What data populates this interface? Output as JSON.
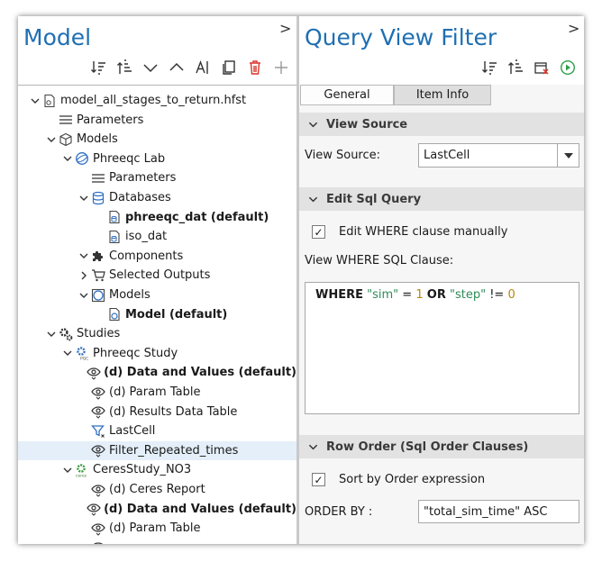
{
  "model_panel": {
    "title": "Model",
    "collapse": ">",
    "toolbar_icons": [
      "sort-descending-icon",
      "sort-ascending-icon",
      "collapse-down-icon",
      "expand-up-icon",
      "rename-ai-icon",
      "copy-icon",
      "delete-icon",
      "add-icon"
    ],
    "tree": [
      {
        "label": "model_all_stages_to_return.hfst",
        "indent": 0,
        "arrow": "down",
        "icon": "file-icon",
        "bold": false
      },
      {
        "label": "Parameters",
        "indent": 1,
        "arrow": "none",
        "icon": "list-icon",
        "bold": false
      },
      {
        "label": "Models",
        "indent": 1,
        "arrow": "down",
        "icon": "cube-icon",
        "bold": false
      },
      {
        "label": "Phreeqc Lab",
        "indent": 2,
        "arrow": "down",
        "icon": "globe-icon",
        "bold": false
      },
      {
        "label": "Parameters",
        "indent": 3,
        "arrow": "none",
        "icon": "list-icon",
        "bold": false
      },
      {
        "label": "Databases",
        "indent": 3,
        "arrow": "down",
        "icon": "database-icon",
        "bold": false
      },
      {
        "label": "phreeqc_dat (default)",
        "indent": 4,
        "arrow": "none",
        "icon": "db-file-icon",
        "bold": true
      },
      {
        "label": "iso_dat",
        "indent": 4,
        "arrow": "none",
        "icon": "db-file-icon",
        "bold": false
      },
      {
        "label": "Components",
        "indent": 3,
        "arrow": "down",
        "icon": "puzzle-icon",
        "bold": false
      },
      {
        "label": "Selected Outputs",
        "indent": 3,
        "arrow": "right",
        "icon": "cart-icon",
        "bold": false
      },
      {
        "label": "Models",
        "indent": 3,
        "arrow": "down",
        "icon": "model-circle-icon",
        "bold": false
      },
      {
        "label": "Model (default)",
        "indent": 4,
        "arrow": "none",
        "icon": "model-file-icon",
        "bold": true
      },
      {
        "label": "Studies",
        "indent": 1,
        "arrow": "down",
        "icon": "gears-icon",
        "bold": false
      },
      {
        "label": "Phreeqc Study",
        "indent": 2,
        "arrow": "down",
        "icon": "pqc-gear-icon",
        "bold": false
      },
      {
        "label": "(d) Data and Values (default)",
        "indent": 3,
        "arrow": "none",
        "icon": "eye-icon",
        "bold": true
      },
      {
        "label": "(d) Param Table",
        "indent": 3,
        "arrow": "none",
        "icon": "eye-icon",
        "bold": false
      },
      {
        "label": "(d) Results Data Table",
        "indent": 3,
        "arrow": "none",
        "icon": "eye-icon",
        "bold": false
      },
      {
        "label": "LastCell",
        "indent": 3,
        "arrow": "none",
        "icon": "filter-icon",
        "bold": false
      },
      {
        "label": "Filter_Repeated_times",
        "indent": 3,
        "arrow": "none",
        "icon": "eye-icon",
        "bold": false,
        "selected": true
      },
      {
        "label": "CeresStudy_NO3",
        "indent": 2,
        "arrow": "down",
        "icon": "ceres-gear-icon",
        "bold": false
      },
      {
        "label": "(d) Ceres Report",
        "indent": 3,
        "arrow": "none",
        "icon": "eye-icon",
        "bold": false
      },
      {
        "label": "(d) Data and Values (default)",
        "indent": 3,
        "arrow": "none",
        "icon": "eye-icon",
        "bold": true
      },
      {
        "label": "(d) Param Table",
        "indent": 3,
        "arrow": "none",
        "icon": "eye-icon",
        "bold": false
      },
      {
        "label": "",
        "indent": 3,
        "arrow": "none",
        "icon": "eye-icon",
        "bold": false
      }
    ]
  },
  "filter_panel": {
    "title": "Query View Filter",
    "collapse": ">",
    "toolbar_icons": [
      "sort-descending-icon",
      "sort-ascending-icon",
      "clear-filter-icon",
      "run-icon"
    ],
    "tabs": [
      "General",
      "Item Info"
    ],
    "view_source_section": "View Source",
    "view_source_label": "View Source:",
    "view_source_value": "LastCell",
    "sql_section": "Edit Sql Query",
    "edit_where_checkbox": "Edit WHERE clause manually",
    "edit_where_checked": "✓",
    "where_label": "View WHERE SQL Clause:",
    "sql": {
      "kw_where": "WHERE",
      "col1": "\"sim\"",
      "eq": "=",
      "val1": "1",
      "kw_or": "OR",
      "col2": "\"step\"",
      "neq": "!=",
      "val2": "0"
    },
    "row_order_section": "Row Order (Sql Order Clauses)",
    "sort_checkbox": "Sort by Order expression",
    "sort_checked": "✓",
    "order_by_label": "ORDER BY :",
    "order_by_value": "\"total_sim_time\" ASC"
  },
  "colors": {
    "title_blue": "#1f6fb2",
    "delete_red": "#d9342b",
    "run_green": "#2e9e4a",
    "selection": "#e4eff9"
  }
}
